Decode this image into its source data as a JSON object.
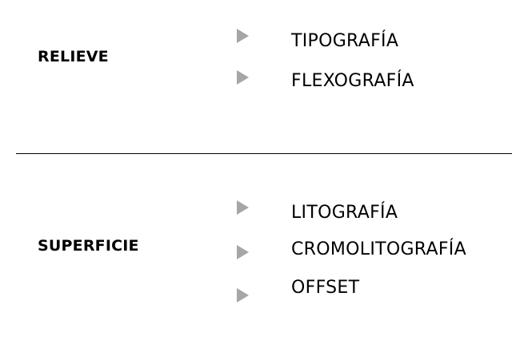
{
  "groups": [
    {
      "category": "RELIEVE",
      "items": [
        "TIPOGRAFÍA",
        "FLEXOGRAFÍA"
      ]
    },
    {
      "category": "SUPERFICIE",
      "items": [
        "LITOGRAFÍA",
        "CROMOLITOGRAFÍA",
        "OFFSET"
      ]
    }
  ],
  "colors": {
    "arrow": "#a6a6a6",
    "text": "#000000",
    "divider": "#000000"
  },
  "icons": {
    "bullet": "triangle-right-icon"
  }
}
